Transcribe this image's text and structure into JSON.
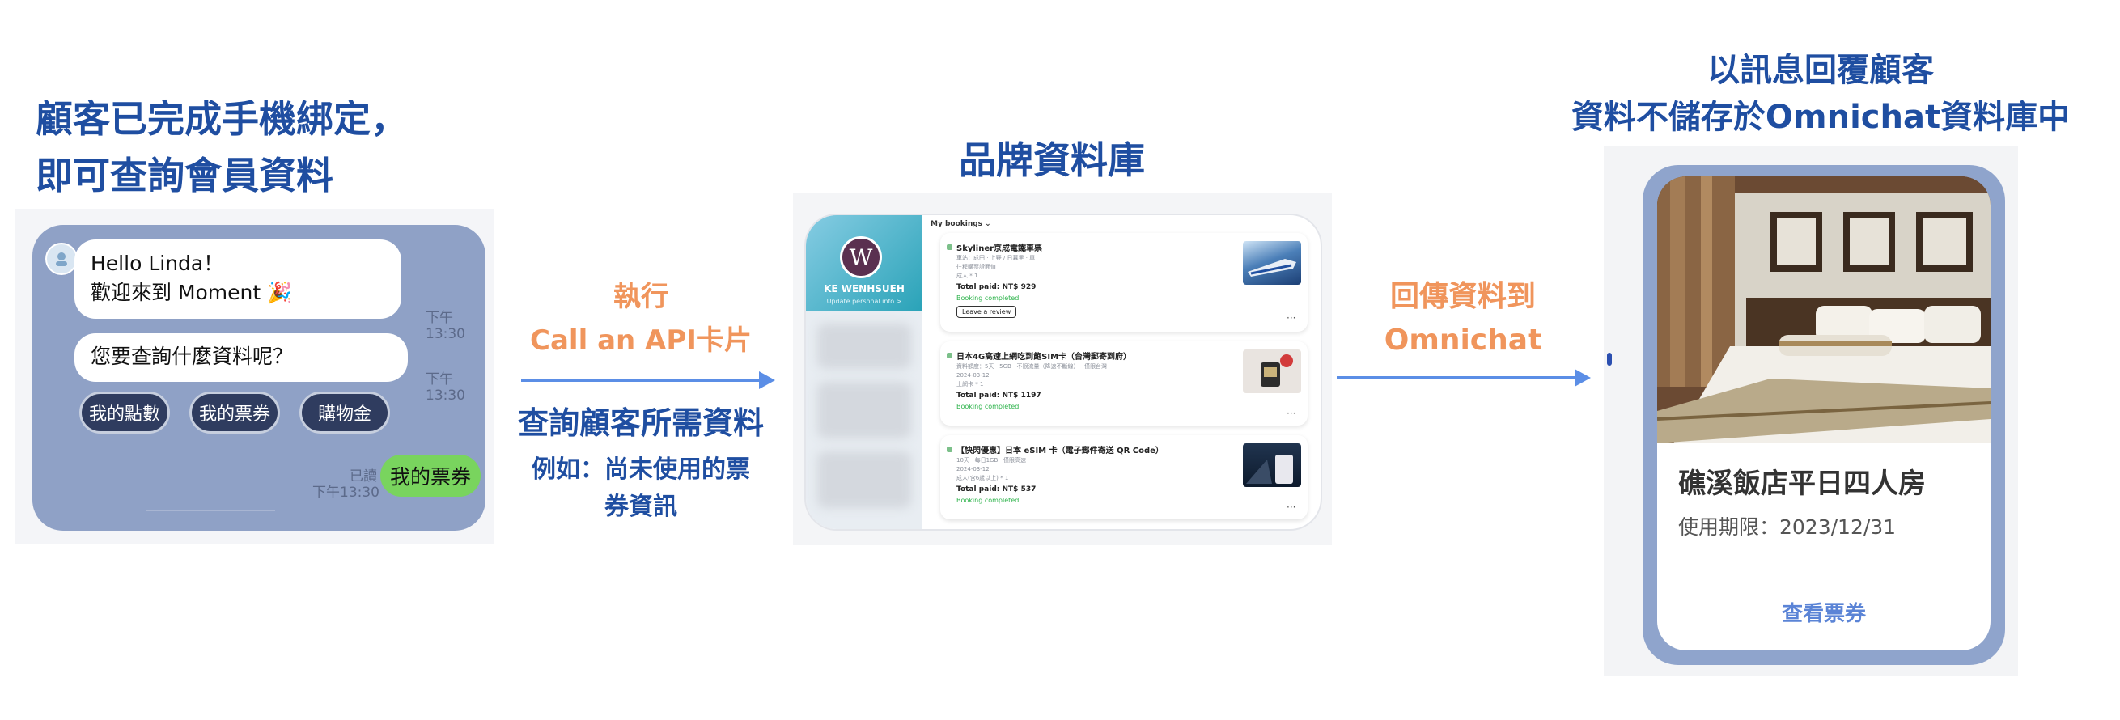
{
  "section1": {
    "title_line1": "顧客已完成手機綁定，",
    "title_line2": "即可查詢會員資料",
    "chat": {
      "greeting_line1": "Hello Linda！",
      "greeting_line2": "歡迎來到 Moment 🎉",
      "time1": "下午13:30",
      "question": "您要查詢什麼資料呢？",
      "time2": "下午13:30",
      "quick_replies": [
        "我的點數",
        "我的票券",
        "購物金"
      ],
      "read_label": "已讀",
      "time3": "下午13:30",
      "user_reply": "我的票券"
    }
  },
  "section2": {
    "action_line1": "執行",
    "action_line2": "Call an API卡片",
    "subtitle": "查詢顧客所需資料",
    "example_line1": "例如：尚未使用的票",
    "example_line2": "券資訊"
  },
  "section3": {
    "title": "品牌資料庫",
    "profile": {
      "avatar_letter": "W",
      "name": "KE WENHSUEH",
      "update_link": "Update personal info  >"
    },
    "my_bookings": "My bookings ⌄",
    "bookings": [
      {
        "title": "Skyliner京成電鐵車票",
        "details": [
          "車站：成田 · 上野 / 日暮里 · 單",
          "往程購票證面值",
          "成人 * 1"
        ],
        "paid": "Total paid: NT$ 929",
        "status": "Booking completed",
        "review": "Leave a review",
        "more": "···"
      },
      {
        "title": "日本4G高速上網吃到飽SIM卡（台灣郵寄到府）",
        "details": [
          "資料額度：5天 · 5GB · 不限流量（降速不斷線） · 僅限台灣",
          "2024-03-12",
          "上網卡 * 1"
        ],
        "paid": "Total paid: NT$ 1197",
        "status": "Booking completed",
        "more": "···"
      },
      {
        "title": "【快閃優惠】日本 eSIM 卡（電子郵件寄送 QR Code）",
        "details": [
          "10天 · 每日1GB · 僅限高速",
          "2024-03-12",
          "成人(含6歲以上) * 1"
        ],
        "paid": "Total paid: NT$ 537",
        "status": "Booking completed",
        "more": "···"
      }
    ]
  },
  "section4": {
    "line1": "回傳資料到",
    "line2": "Omnichat"
  },
  "section5": {
    "title_line1": "以訊息回覆顧客",
    "title_line2": "資料不儲存於Omnichat資料庫中",
    "card": {
      "name": "礁溪飯店平日四人房",
      "validity": "使用期限：2023/12/31",
      "button": "查看票券"
    }
  },
  "colors": {
    "heading_blue": "#1f4ea1",
    "action_orange": "#f0955c",
    "arrow_blue": "#5b8ee6",
    "chat_bg": "#8fa1c6",
    "pill_bg": "#2f3c5f",
    "reply_green": "#79d45e",
    "card_border": "#8fa4cc",
    "link_blue": "#5b84d6"
  }
}
